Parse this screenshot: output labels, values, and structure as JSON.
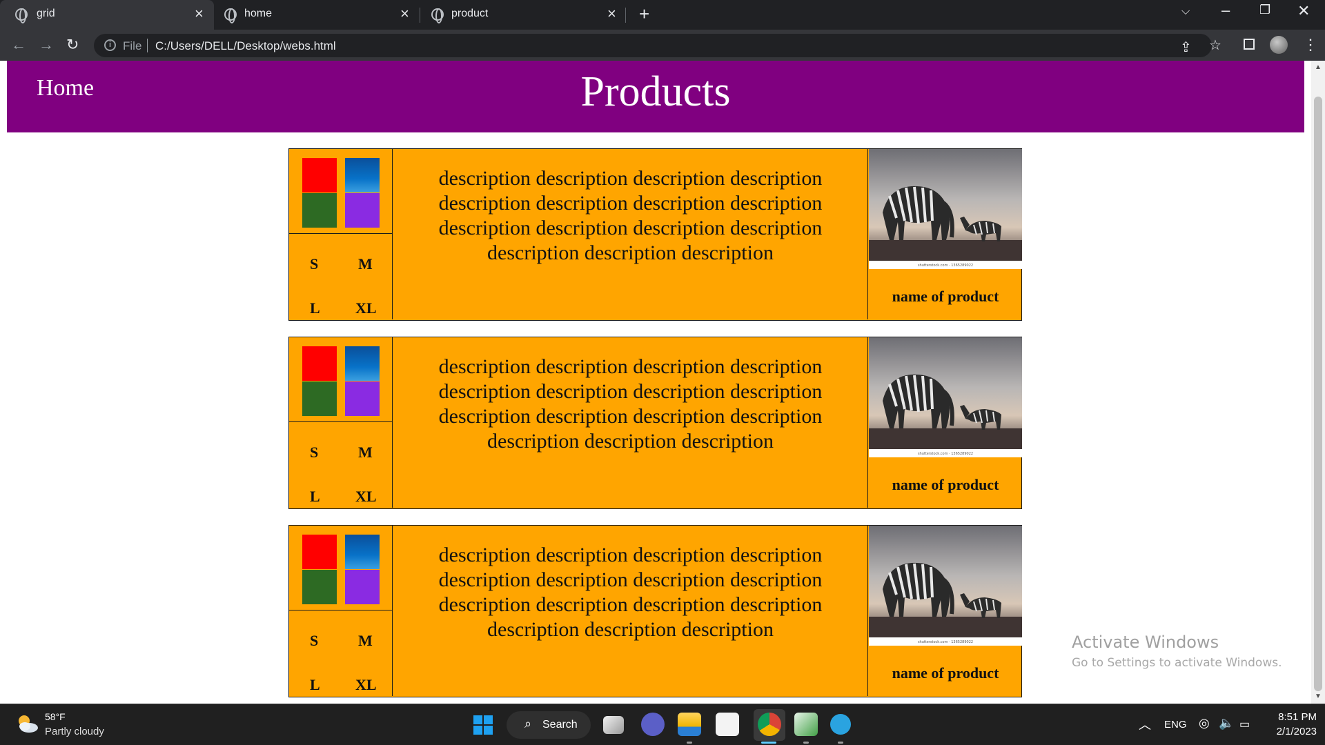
{
  "browser": {
    "tabs": [
      {
        "title": "grid"
      },
      {
        "title": "home"
      },
      {
        "title": "product"
      }
    ],
    "address": {
      "scheme_label": "File",
      "url": "C:/Users/DELL/Desktop/webs.html"
    }
  },
  "page": {
    "nav": {
      "home_label": "Home"
    },
    "title": "Products",
    "products": [
      {
        "sizes": [
          "S",
          "M",
          "L",
          "XL"
        ],
        "description": "description description description description description description description description description description description description description description description",
        "name": "name of product",
        "image_caption": "shutterstock.com · 1365289022"
      },
      {
        "sizes": [
          "S",
          "M",
          "L",
          "XL"
        ],
        "description": "description description description description description description description description description description description description description description description",
        "name": "name of product",
        "image_caption": "shutterstock.com · 1365289022"
      },
      {
        "sizes": [
          "S",
          "M",
          "L",
          "XL"
        ],
        "description": "description description description description description description description description description description description description description description description",
        "name": "name of product",
        "image_caption": "shutterstock.com · 1365289022"
      }
    ],
    "colors": {
      "header": "#800080",
      "card": "#ffa500",
      "swatches": [
        "#ff0000",
        "#0872c8",
        "#2d6a23",
        "#8a2be2"
      ]
    }
  },
  "watermark": {
    "title": "Activate Windows",
    "subtitle": "Go to Settings to activate Windows."
  },
  "taskbar": {
    "weather": {
      "temp": "58°F",
      "condition": "Partly cloudy"
    },
    "search_label": "Search",
    "language": "ENG",
    "time": "8:51 PM",
    "date": "2/1/2023"
  }
}
